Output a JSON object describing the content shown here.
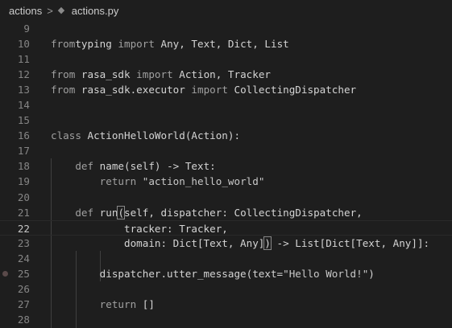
{
  "breadcrumb": {
    "folder": "actions",
    "separator": ">",
    "file": "actions.py",
    "file_icon": "python-file-icon"
  },
  "current_line": 22,
  "breakpoint_line": 25,
  "lines": [
    {
      "n": "9",
      "seg": []
    },
    {
      "n": "10",
      "seg": [
        [
          "kw",
          "from"
        ],
        [
          "",
          "typing "
        ],
        [
          "kw",
          "import"
        ],
        [
          "",
          " Any, Text, Dict, List"
        ]
      ]
    },
    {
      "n": "11",
      "seg": []
    },
    {
      "n": "12",
      "seg": [
        [
          "kw",
          "from"
        ],
        [
          "",
          " rasa_sdk "
        ],
        [
          "kw",
          "import"
        ],
        [
          "",
          " Action, Tracker"
        ]
      ]
    },
    {
      "n": "13",
      "seg": [
        [
          "kw",
          "from"
        ],
        [
          "",
          " rasa_sdk.executor "
        ],
        [
          "kw",
          "import"
        ],
        [
          "",
          " CollectingDispatcher"
        ]
      ]
    },
    {
      "n": "14",
      "seg": []
    },
    {
      "n": "15",
      "seg": []
    },
    {
      "n": "16",
      "seg": [
        [
          "kw",
          "class"
        ],
        [
          "",
          " ActionHelloWorld(Action):"
        ]
      ]
    },
    {
      "n": "17",
      "seg": []
    },
    {
      "n": "18",
      "seg": [
        [
          "",
          "    "
        ],
        [
          "kw",
          "def"
        ],
        [
          "",
          " name(self) -> Text:"
        ]
      ]
    },
    {
      "n": "19",
      "seg": [
        [
          "",
          "        "
        ],
        [
          "kw",
          "return"
        ],
        [
          "str",
          " \"action_hello_world\""
        ]
      ]
    },
    {
      "n": "20",
      "seg": []
    },
    {
      "n": "21",
      "seg": [
        [
          "",
          "    "
        ],
        [
          "kw",
          "def"
        ],
        [
          "",
          " run"
        ],
        [
          "bracket",
          "("
        ],
        [
          "",
          "self, dispatcher: CollectingDispatcher,"
        ]
      ]
    },
    {
      "n": "22",
      "seg": [
        [
          "",
          "            tracker: Tracker,"
        ]
      ]
    },
    {
      "n": "23",
      "seg": [
        [
          "",
          "            domain: Dict[Text, Any]"
        ],
        [
          "bracket",
          ")"
        ],
        [
          "",
          " -> List[Dict[Text, Any]]:"
        ]
      ]
    },
    {
      "n": "24",
      "seg": []
    },
    {
      "n": "25",
      "seg": [
        [
          "",
          "        dispatcher.utter_message(text="
        ],
        [
          "str",
          "\"Hello World!\""
        ],
        [
          "",
          ")"
        ]
      ]
    },
    {
      "n": "26",
      "seg": []
    },
    {
      "n": "27",
      "seg": [
        [
          "",
          "        "
        ],
        [
          "kw",
          "return"
        ],
        [
          "",
          " []"
        ]
      ]
    },
    {
      "n": "28",
      "seg": []
    }
  ]
}
